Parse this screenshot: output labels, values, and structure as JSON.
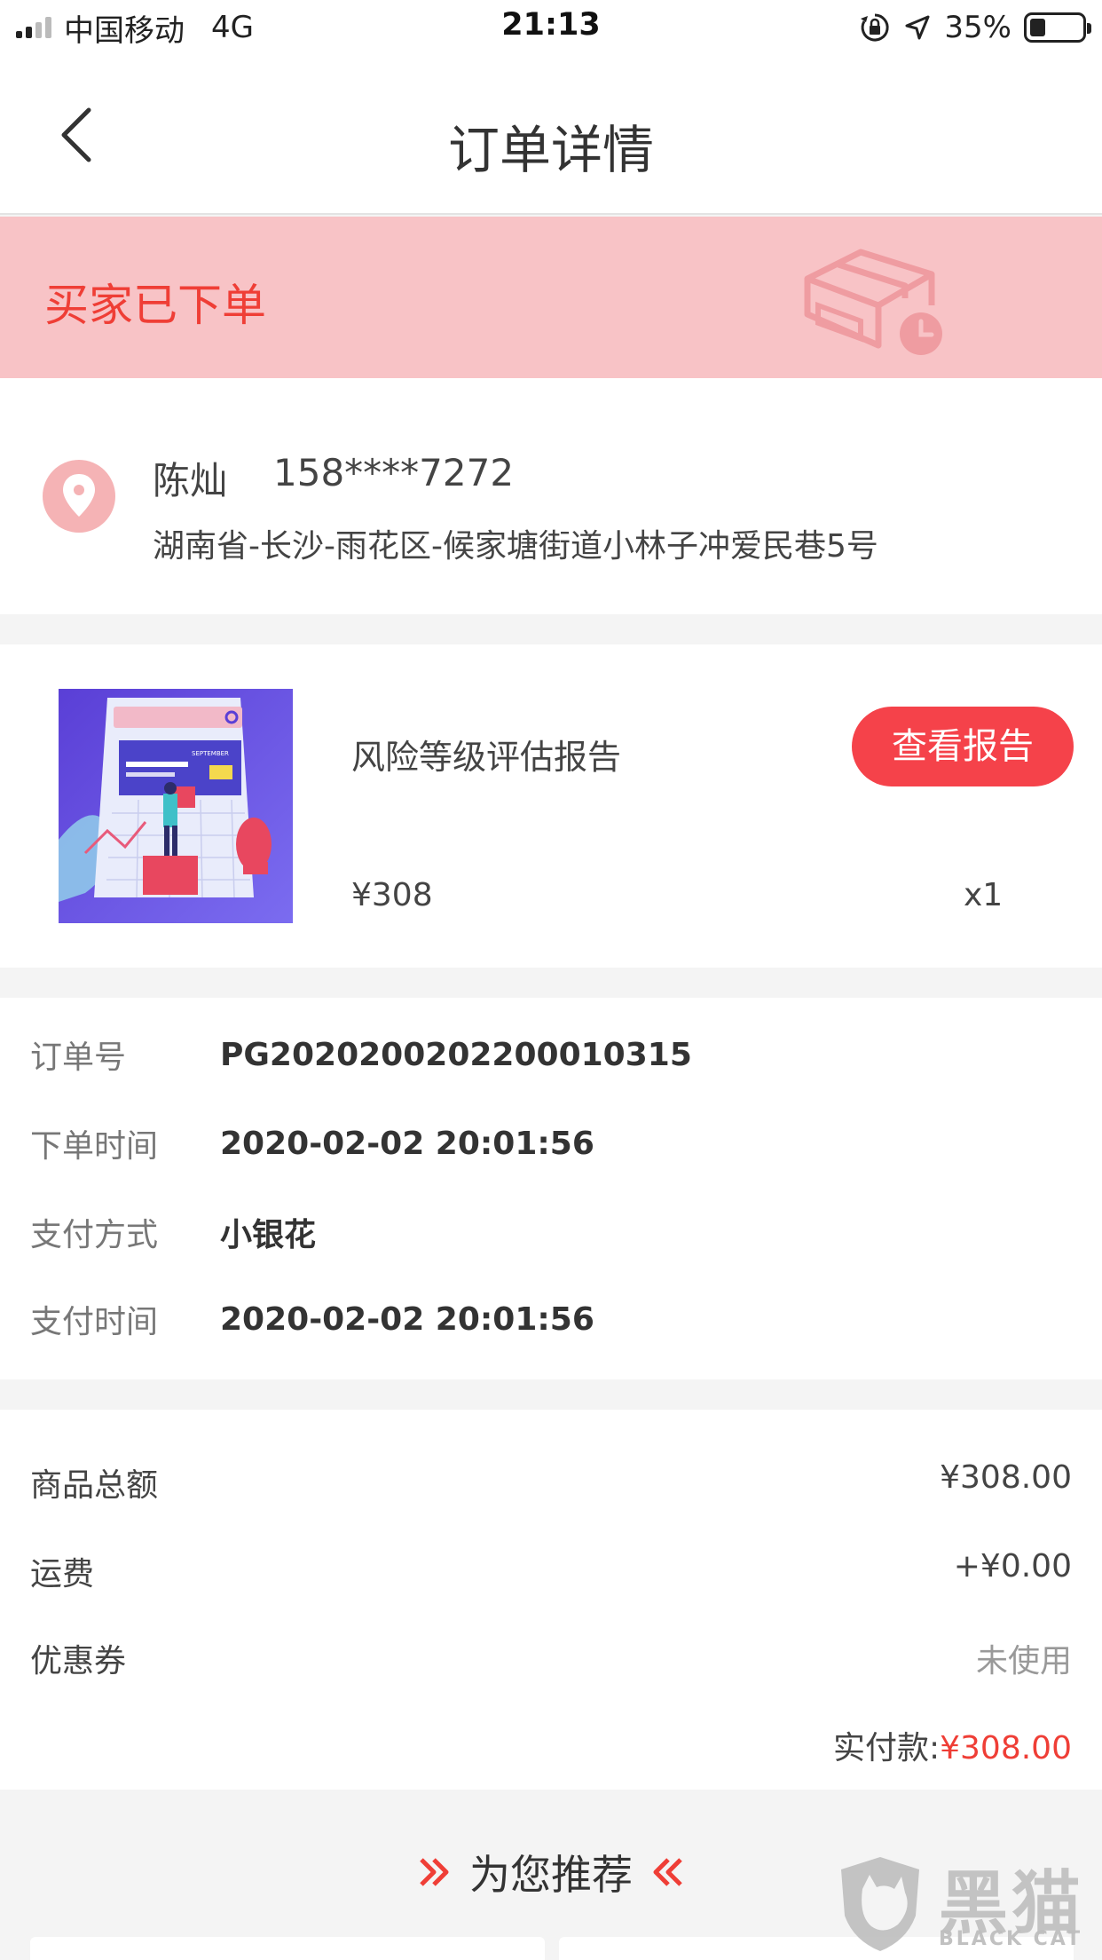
{
  "status_bar": {
    "carrier": "中国移动",
    "network": "4G",
    "time": "21:13",
    "battery": "35%"
  },
  "nav": {
    "title": "订单详情",
    "back_icon": "chevron-left-icon"
  },
  "banner": {
    "status_text": "买家已下单",
    "icon": "box-clock-icon",
    "bg_color": "#f8c3c6",
    "text_color": "#ef3e36"
  },
  "address": {
    "icon": "location-pin-icon",
    "name": "陈灿",
    "phone": "158****7272",
    "line": "湖南省-长沙-雨花区-候家塘街道小林子冲爱民巷5号"
  },
  "product": {
    "title": "风险等级评估报告",
    "price": "¥308",
    "quantity": "x1",
    "button_label": "查看报告",
    "image_text": "SEPTEMBER"
  },
  "order_info": {
    "rows": [
      {
        "label": "订单号",
        "value": "PG2020200202200010315"
      },
      {
        "label": "下单时间",
        "value": "2020-02-02 20:01:56"
      },
      {
        "label": "支付方式",
        "value": "小银花"
      },
      {
        "label": "支付时间",
        "value": "2020-02-02 20:01:56"
      }
    ]
  },
  "amount": {
    "subtotal_label": "商品总额",
    "subtotal_value": "¥308.00",
    "shipping_label": "运费",
    "shipping_value": "+¥0.00",
    "coupon_label": "优惠券",
    "coupon_value": "未使用",
    "paid_label": "实付款:",
    "paid_value": "¥308.00"
  },
  "recommend": {
    "title": "为您推荐",
    "left_icon": "double-chevron-right-icon",
    "right_icon": "double-chevron-left-icon"
  },
  "watermark": {
    "cn": "黑猫",
    "en": "BLACK CAT"
  }
}
